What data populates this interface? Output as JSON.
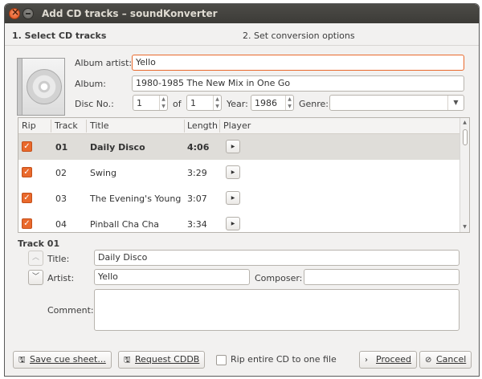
{
  "window": {
    "title": "Add CD tracks – soundKonverter"
  },
  "steps": {
    "step1": "1. Select CD tracks",
    "step2": "2. Set conversion options"
  },
  "album": {
    "artist_label": "Album artist:",
    "artist_value": "Yello",
    "album_label": "Album:",
    "album_value": "1980-1985 The New Mix in One Go",
    "disc_label": "Disc No.:",
    "disc_value": "1",
    "of_label": "of",
    "of_value": "1",
    "year_label": "Year:",
    "year_value": "1986",
    "genre_label": "Genre:",
    "genre_value": ""
  },
  "table": {
    "headers": {
      "rip": "Rip",
      "track": "Track",
      "title": "Title",
      "length": "Length",
      "player": "Player"
    },
    "rows": [
      {
        "track": "01",
        "title": "Daily Disco",
        "length": "4:06",
        "checked": true
      },
      {
        "track": "02",
        "title": "Swing",
        "length": "3:29",
        "checked": true
      },
      {
        "track": "03",
        "title": "The Evening's Young",
        "length": "3:07",
        "checked": true
      },
      {
        "track": "04",
        "title": "Pinball Cha Cha",
        "length": "3:34",
        "checked": true
      }
    ]
  },
  "track": {
    "heading": "Track 01",
    "title_label": "Title:",
    "title_value": "Daily Disco",
    "artist_label": "Artist:",
    "artist_value": "Yello",
    "composer_label": "Composer:",
    "composer_value": "",
    "comment_label": "Comment:",
    "comment_value": ""
  },
  "buttons": {
    "save_cue": "Save cue sheet...",
    "request_cddb": "Request CDDB",
    "rip_entire": "Rip entire CD to one file",
    "proceed": "Proceed",
    "cancel": "Cancel"
  },
  "colors": {
    "accent": "#e9692c",
    "titlebar": "#3c3b37",
    "window_bg": "#f2f1f0"
  }
}
